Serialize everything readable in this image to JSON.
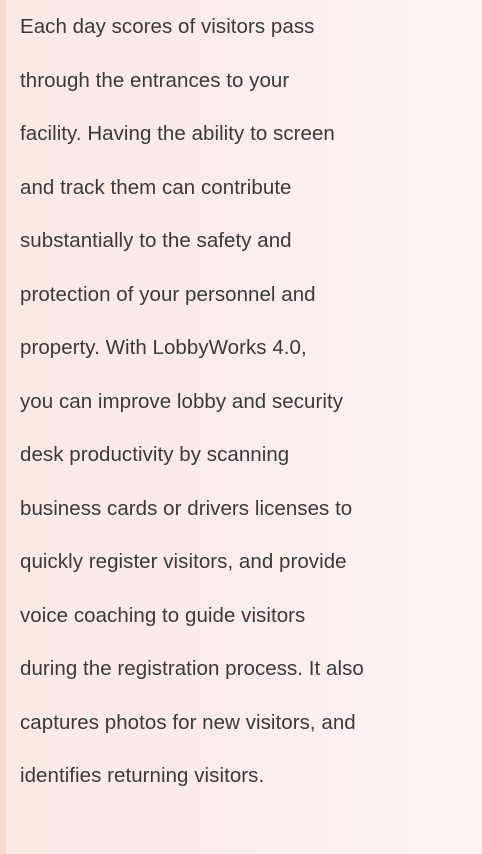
{
  "paragraph": {
    "lines": [
      "Each day scores of visitors pass",
      "through the entrances to your",
      "facility. Having the ability to screen",
      "and track them can contribute",
      "substantially to the safety and",
      "protection of your personnel and",
      "property. With LobbyWorks 4.0,",
      "you can improve lobby and security",
      "desk productivity by scanning",
      "business cards or drivers licenses to",
      "quickly register visitors, and provide",
      "voice coaching to guide visitors",
      "during the registration process. It also",
      "captures photos for new visitors, and",
      "identifies returning visitors."
    ]
  }
}
